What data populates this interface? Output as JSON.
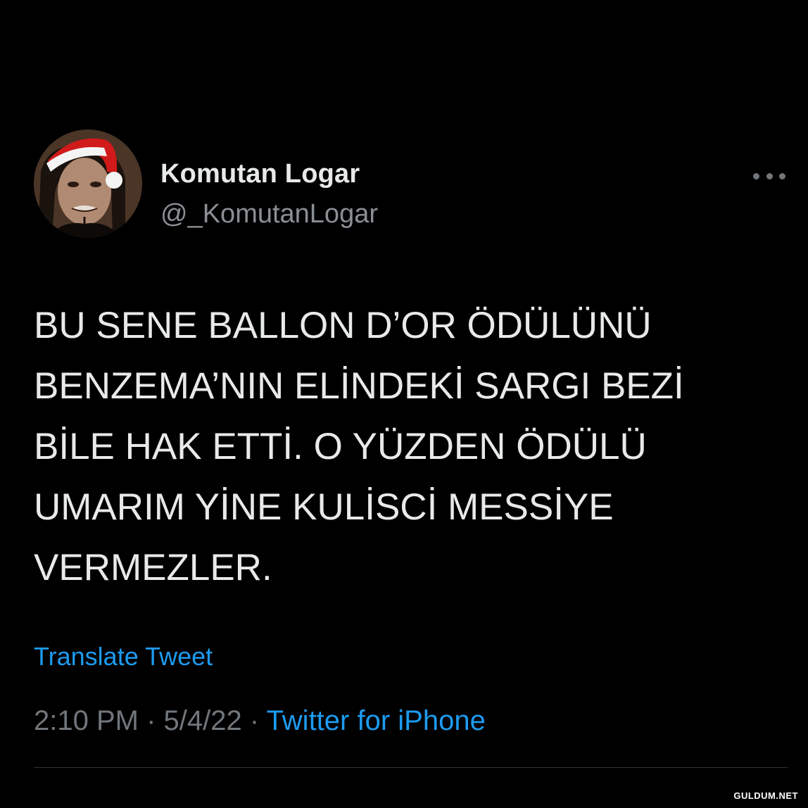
{
  "user": {
    "display_name": "Komutan Logar",
    "handle": "@_KomutanLogar",
    "avatar_icon": "profile-photo-santa-hat"
  },
  "tweet": {
    "lines": [
      "BU SENE BALLON D’OR ÖDÜLÜNÜ",
      "BENZEMA’NIN ELİNDEKİ SARGI BEZİ",
      "BİLE HAK ETTİ. O YÜZDEN ÖDÜLÜ",
      "UMARIM YİNE KULİSCİ MESSİYE",
      "VERMEZLER."
    ]
  },
  "actions": {
    "translate_label": "Translate Tweet",
    "more_icon": "ellipsis-icon"
  },
  "meta": {
    "time": "2:10 PM",
    "separator": " · ",
    "date": "5/4/22",
    "source": "Twitter for iPhone"
  },
  "watermark": "GULDUM.NET",
  "colors": {
    "background": "#000000",
    "text_primary": "#e7e9ea",
    "text_secondary": "#71767b",
    "link": "#1d9bf0",
    "divider": "#2f3336"
  }
}
